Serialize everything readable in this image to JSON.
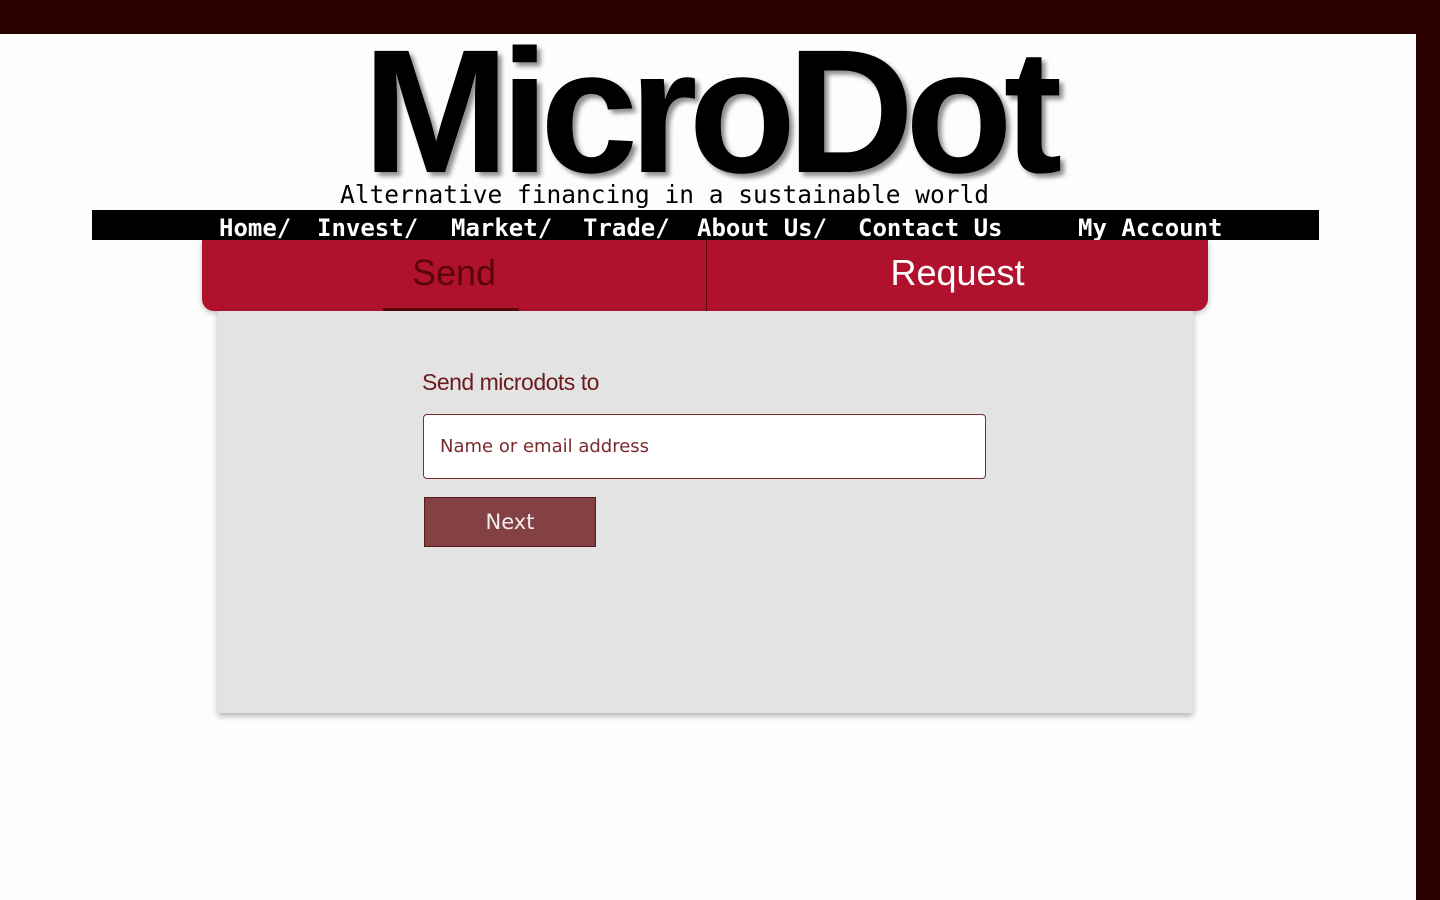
{
  "brand": {
    "logo_text": "MicroDot",
    "tagline": "Alternative financing in a sustainable world"
  },
  "nav": {
    "items": [
      {
        "label": "Home/"
      },
      {
        "label": "Invest/"
      },
      {
        "label": "Market/"
      },
      {
        "label": "Trade/"
      },
      {
        "label": "About Us/"
      },
      {
        "label": "Contact Us"
      }
    ],
    "account_label": "My Account"
  },
  "tabs": [
    {
      "label": "Send",
      "active": true
    },
    {
      "label": "Request",
      "active": false
    }
  ],
  "form": {
    "label": "Send microdots to",
    "recipient": {
      "value": "",
      "placeholder": "Name or email address"
    },
    "next_label": "Next"
  },
  "colors": {
    "frame": "#2a0000",
    "tab_bar": "#b0122e",
    "active_tab_text": "#5a0608",
    "card_bg": "#e4e3e3",
    "button_bg": "#834143",
    "label_text": "#6b1a1e"
  }
}
